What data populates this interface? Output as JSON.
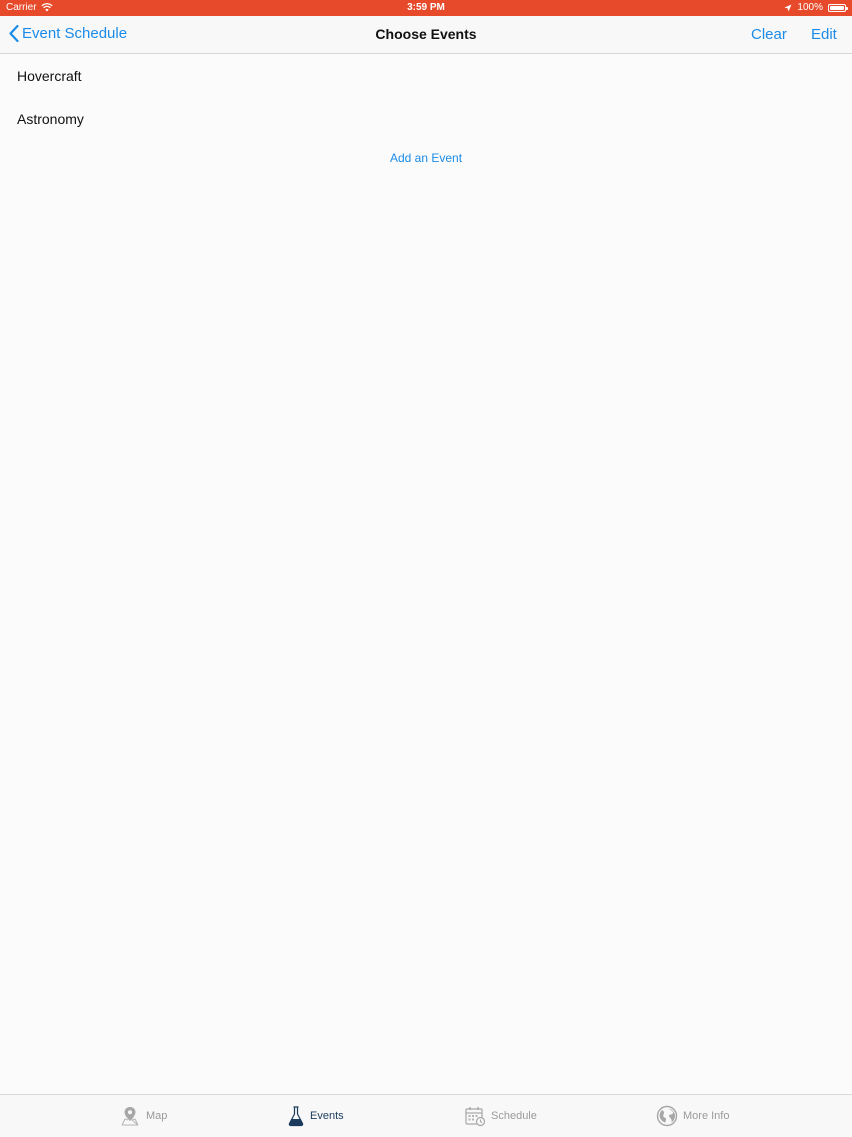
{
  "status_bar": {
    "carrier": "Carrier",
    "time": "3:59 PM",
    "battery": "100%"
  },
  "nav": {
    "back_label": "Event Schedule",
    "title": "Choose Events",
    "clear_label": "Clear",
    "edit_label": "Edit"
  },
  "events": [
    {
      "label": "Hovercraft"
    },
    {
      "label": "Astronomy"
    }
  ],
  "add_event_label": "Add an Event",
  "tabs": [
    {
      "label": "Map",
      "icon": "map-pin-icon"
    },
    {
      "label": "Events",
      "icon": "flask-icon",
      "active": true
    },
    {
      "label": "Schedule",
      "icon": "calendar-icon"
    },
    {
      "label": "More Info",
      "icon": "globe-icon"
    }
  ],
  "colors": {
    "status_bar": "#e64a2b",
    "accent": "#1a8be8",
    "active_tab": "#1b3a5c",
    "inactive_tab": "#9a9a9a"
  }
}
